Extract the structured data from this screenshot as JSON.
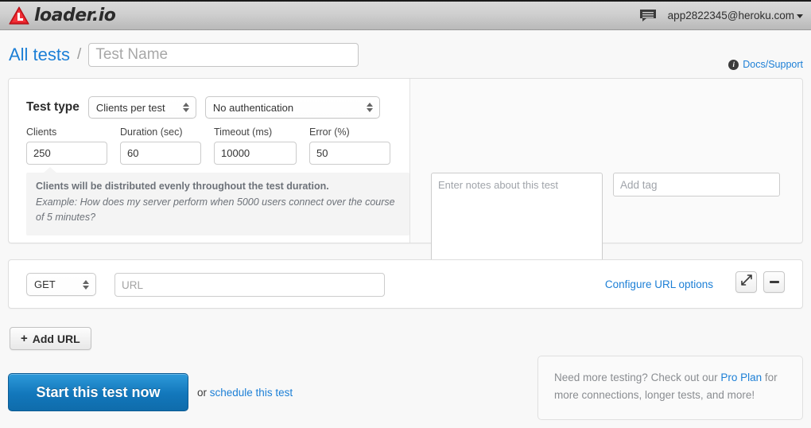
{
  "topbar": {
    "brand_name": "loader.io",
    "brand_logo_icon": "loader-triangle-logo",
    "chat_icon": "chat-bubble-icon",
    "user_email": "app2822345@heroku.com"
  },
  "breadcrumb": {
    "all_tests_label": "All tests",
    "separator": "/",
    "test_name_placeholder": "Test Name",
    "test_name_value": ""
  },
  "docs": {
    "info_icon": "info-circle-icon",
    "label": "Docs/Support"
  },
  "test_panel": {
    "test_type_label": "Test type",
    "test_type_value": "Clients per test",
    "auth_value": "No authentication",
    "fields": [
      {
        "label": "Clients",
        "value": "250"
      },
      {
        "label": "Duration (sec)",
        "value": "60"
      },
      {
        "label": "Timeout (ms)",
        "value": "10000"
      },
      {
        "label": "Error (%)",
        "value": "50"
      }
    ],
    "help_title": "Clients will be distributed evenly throughout the test duration.",
    "help_example": "Example: How does my server perform when 5000 users connect over the course of 5 minutes?",
    "notes_placeholder": "Enter notes about this test",
    "notes_value": "",
    "tag_placeholder": "Add tag",
    "tag_value": ""
  },
  "url_panel": {
    "method_value": "GET",
    "url_placeholder": "URL",
    "url_value": "",
    "configure_label": "Configure URL options",
    "expand_icon": "expand-diagonal-arrow-icon",
    "remove_icon": "minus-icon"
  },
  "actions": {
    "add_url_plus": "+",
    "add_url_label": "Add URL",
    "start_label": "Start this test now",
    "or_text": "or ",
    "schedule_label": "schedule this test"
  },
  "promo": {
    "text_before": "Need more testing? Check out our ",
    "link_label": "Pro Plan",
    "text_after": " for more connections, longer tests, and more!"
  },
  "colors": {
    "accent_blue": "#1c7fd6",
    "brand_red": "#e01b22",
    "start_button_blue": "#1277bb",
    "page_bg": "#f8f8f8"
  }
}
